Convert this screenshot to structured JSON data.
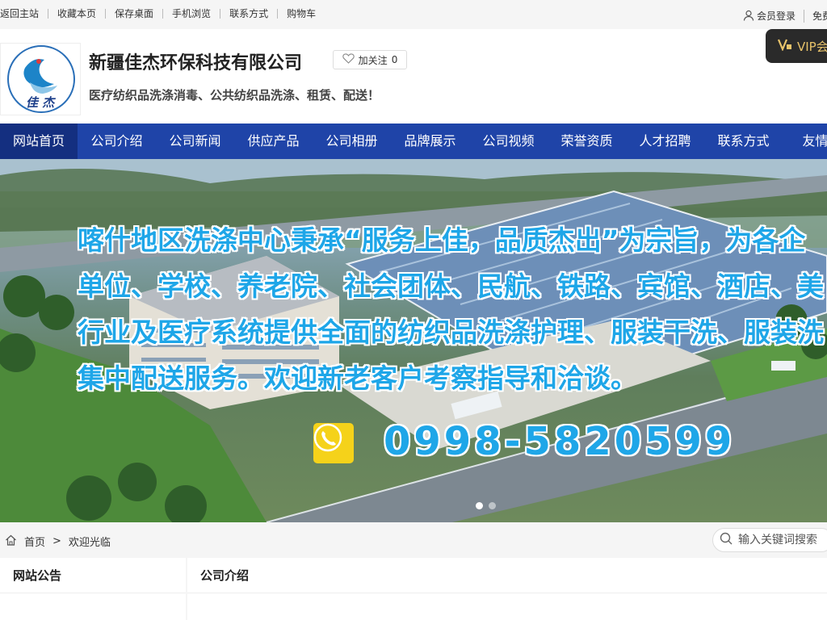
{
  "topbar": {
    "links": [
      "返回主站",
      "收藏本页",
      "保存桌面",
      "手机浏览",
      "联系方式",
      "购物车"
    ],
    "login": "会员登录",
    "free": "免费"
  },
  "header": {
    "logo_text": "佳 杰",
    "company_name": "新疆佳杰环保科技有限公司",
    "follow_label": "加关注",
    "follow_count": "0",
    "slogan": "医疗纺织品洗涤消毒、公共纺织品洗涤、租赁、配送！",
    "vip_label": "VIP会"
  },
  "nav": {
    "items": [
      "网站首页",
      "公司介绍",
      "公司新闻",
      "供应产品",
      "公司相册",
      "品牌展示",
      "公司视频",
      "荣誉资质",
      "人才招聘",
      "联系方式",
      "友情链"
    ]
  },
  "banner": {
    "lines": [
      "喀什地区洗涤中心秉承“服务上佳，品质杰出”为宗旨，为各企",
      "单位、学校、养老院、社会团体、民航、铁路、宾馆、酒店、美",
      "行业及医疗系统提供全面的纺织品洗涤护理、服装干洗、服装洗",
      "集中配送服务。欢迎新老客户考察指导和洽谈。"
    ],
    "phone": "0998-5820599",
    "slides_total": 2,
    "slide_active": 1
  },
  "breadcrumb": {
    "home": "首页",
    "separator": ">",
    "current": "欢迎光临"
  },
  "search": {
    "placeholder": "输入关键词搜索"
  },
  "panels": {
    "left_title": "网站公告",
    "right_title": "公司介绍"
  },
  "colors": {
    "nav_bg": "#1f44a8",
    "nav_active": "#142f80",
    "banner_text": "#1ea6e8",
    "phone_icon_bg": "#f5d21a",
    "vip_bg": "#2a2a2a",
    "vip_text": "#e8c36a"
  },
  "icons": [
    "user-icon",
    "heart-icon",
    "vip-badge-icon",
    "phone-icon",
    "home-icon",
    "search-icon"
  ]
}
